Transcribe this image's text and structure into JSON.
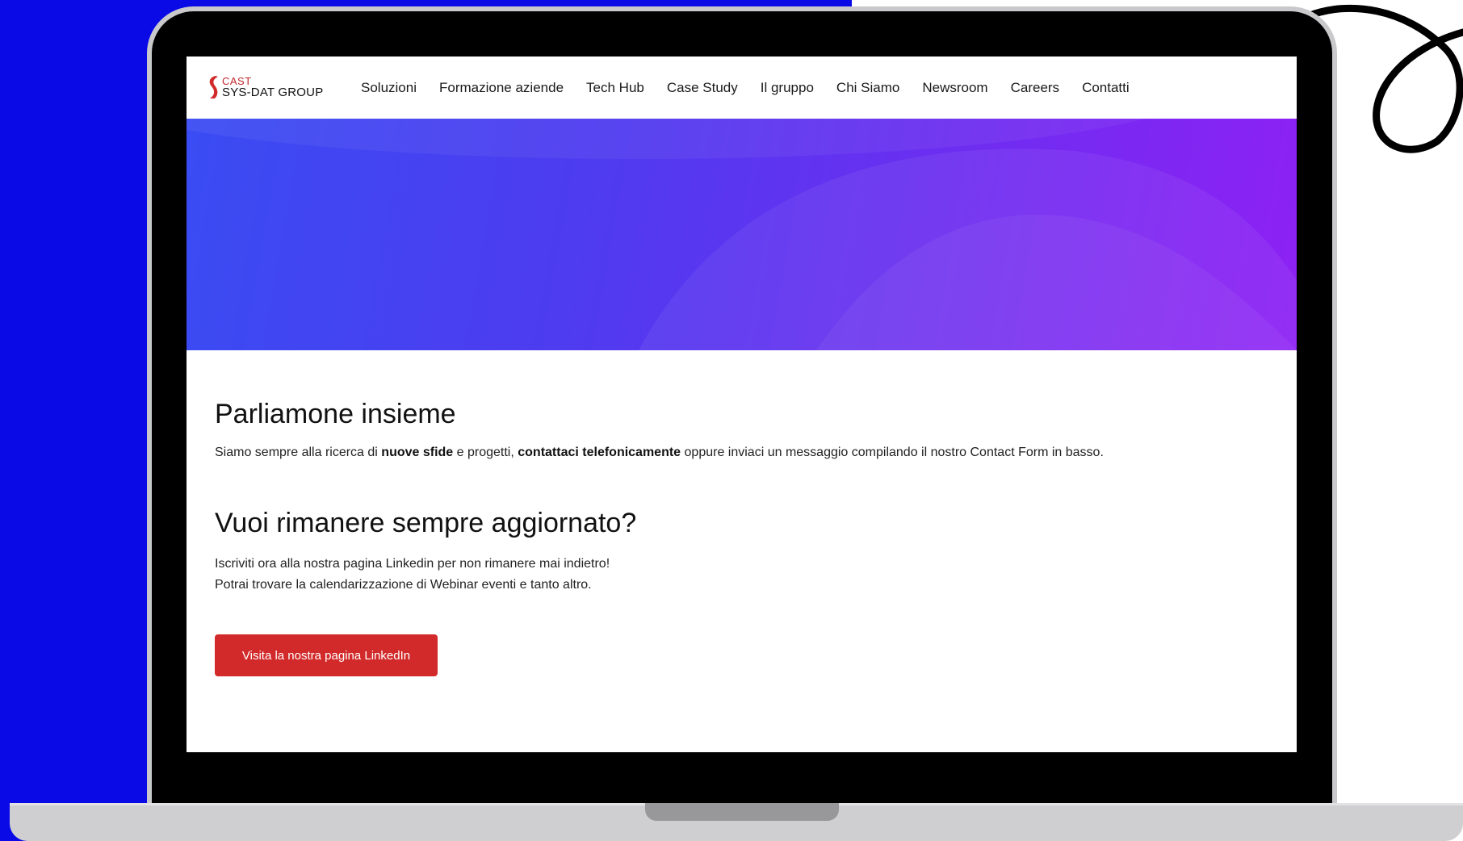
{
  "brand": {
    "logo_line1": "CAST",
    "logo_line2": "SYS-DAT GROUP",
    "accent": "#d22a2a"
  },
  "nav": {
    "items": [
      "Soluzioni",
      "Formazione aziende",
      "Tech Hub",
      "Case Study",
      "Il gruppo",
      "Chi Siamo",
      "Newsroom",
      "Careers",
      "Contatti"
    ]
  },
  "section1": {
    "title": "Parliamone insieme",
    "text_a": "Siamo sempre alla ricerca di ",
    "bold_a": "nuove sfide",
    "text_b": " e progetti, ",
    "bold_b": "contattaci telefonicamente",
    "text_c": " oppure inviaci un messaggio compilando il nostro Contact Form in basso."
  },
  "section2": {
    "title": "Vuoi rimanere sempre aggiornato?",
    "line1": "Iscriviti ora alla nostra pagina Linkedin per non rimanere mai indietro!",
    "line2": "Potrai trovare la calendarizzazione di Webinar eventi e tanto altro.",
    "button_label": "Visita la nostra pagina LinkedIn"
  },
  "colors": {
    "background_blue": "#0a0ae6",
    "hero_start": "#3a4cf3",
    "hero_end": "#8e21f4"
  }
}
